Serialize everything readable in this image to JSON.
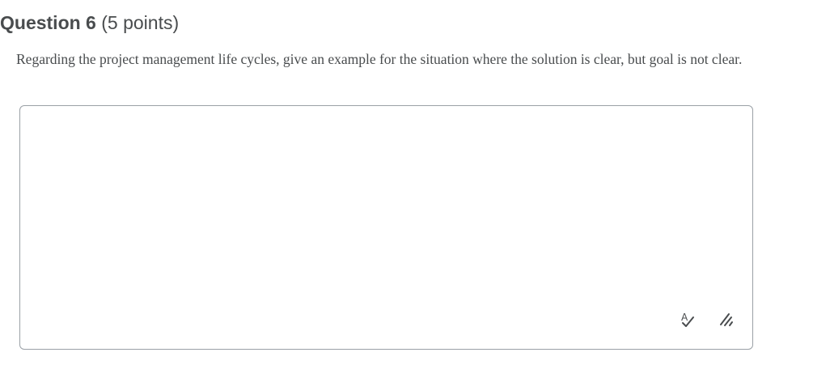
{
  "question": {
    "title": "Question 6",
    "points": "(5 points)",
    "prompt": "Regarding the project management life cycles, give an example for the situation where the solution is clear, but goal is not clear."
  },
  "answer": {
    "value": "",
    "icons": {
      "spellcheck": "spellcheck-icon",
      "resize": "resize-handle-icon"
    }
  }
}
